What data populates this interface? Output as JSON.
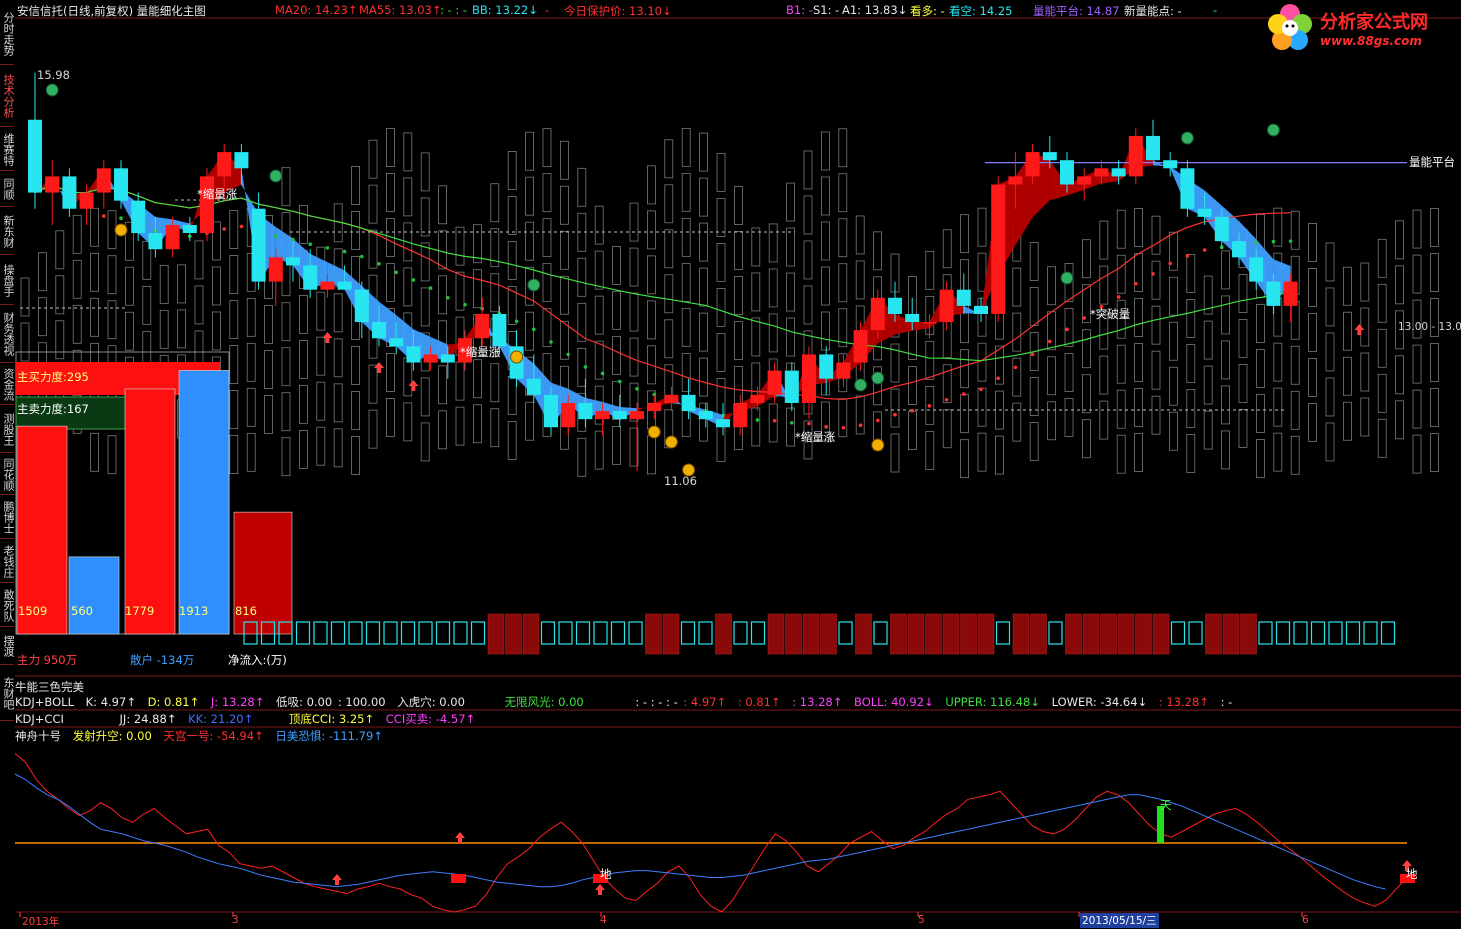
{
  "sidebar": {
    "tabs": [
      {
        "label": "分时走势",
        "active": false
      },
      {
        "label": "技术分析",
        "active": true
      },
      {
        "label": "维赛特",
        "active": false
      },
      {
        "label": "同顺",
        "active": false
      },
      {
        "label": "新东财",
        "active": false
      },
      {
        "label": "操盘手",
        "active": false
      },
      {
        "label": "财务透视",
        "active": false
      },
      {
        "label": "资金流",
        "active": false
      },
      {
        "label": "测股王",
        "active": false
      },
      {
        "label": "同花顺",
        "active": false
      },
      {
        "label": "鹏博士",
        "active": false
      },
      {
        "label": "老钱庄",
        "active": false
      },
      {
        "label": "敢死队",
        "active": false
      },
      {
        "label": "摆渡",
        "active": false
      },
      {
        "label": "东财吧",
        "active": false
      }
    ]
  },
  "header": {
    "title": "安信信托(日线,前复权) 量能细化主图",
    "ma20": "MA20: 14.23↑",
    "ma55": "MA55: 13.03↑",
    "sep1": ": - : -",
    "bb": "BB: 13.22↓",
    "sep2": "-",
    "protect": "今日保护价: 13.10↓",
    "b1": "B1: -",
    "s1": "S1: -",
    "a1": "A1: 13.83↓",
    "kanduo": "看多: -",
    "kankong": "看空: 14.25",
    "platform": "量能平台: 14.87",
    "newpoint": "新量能点: -",
    "sep3": "-"
  },
  "logo": {
    "text": "分析家公式网",
    "url": "www.88gs.com"
  },
  "annotations": {
    "high": "15.98",
    "low": "11.06",
    "price_right": "13.00 - 13.0",
    "platform_label": "量能平台",
    "shrink_vol": "*缩量涨",
    "breakout": "*突破量"
  },
  "capital_panel": {
    "buy_label": "主买力度:295",
    "sell_label": "主卖力度:167",
    "main_force": "主力 950万",
    "retail": "散户 -134万",
    "net_inflow": "净流入:(万)",
    "bars": [
      {
        "value": 1509,
        "color": "#ff1010"
      },
      {
        "value": 560,
        "color": "#2f8fff"
      },
      {
        "value": 1779,
        "color": "#ff1010"
      },
      {
        "value": 1913,
        "color": "#2f8fff"
      },
      {
        "value": 816,
        "color": "#c00000"
      }
    ],
    "bar_labels": [
      "1509",
      "560",
      "1779",
      "1913",
      "816"
    ]
  },
  "indicators": {
    "row1": {
      "name": "牛能三色完美",
      "name2": "KDJ+BOLL",
      "k": "K: 4.97↑",
      "d": "D: 0.81↑",
      "j": "J: 13.28↑",
      "dixi": "低吸: 0.00",
      "v100": ": 100.00",
      "ruhu": "入虎穴: 0.00",
      "wuxian": "无限风光: 0.00",
      "dots": ": - : - : -",
      "v1": ": 4.97↑",
      "v2": ": 0.81↑",
      "v3": ": 13.28↑",
      "boll": "BOLL: 40.92↓",
      "upper": "UPPER: 116.48↓",
      "lower": "LOWER: -34.64↓",
      "v4": ": 13.28↑",
      "v5": ": -"
    },
    "row2": {
      "name": "KDJ+CCI",
      "jj": "JJ: 24.88↑",
      "kk": "KK: 21.20↑",
      "cci": "顶底CCI: 3.25↑",
      "ccibs": "CCI买卖: -4.57↑"
    },
    "row3": {
      "name": "神舟十号",
      "fashe": "发射升空: 0.00",
      "tiangong": "天宫一号: -54.94↑",
      "rimei": "日美恐惧: -111.79↑"
    },
    "marks": {
      "tian": "天",
      "di": "地"
    }
  },
  "xaxis": {
    "labels": [
      "2013年",
      "3",
      "4",
      "5",
      "2013/05/15/三",
      "6"
    ]
  },
  "chart_data": {
    "type": "candlestick",
    "title": "安信信托(日线,前复权) 量能细化主图",
    "high_label": 15.98,
    "low_label": 11.06,
    "ohlc": [
      [
        15.4,
        15.98,
        14.3,
        14.5
      ],
      [
        14.5,
        14.9,
        14.1,
        14.7
      ],
      [
        14.7,
        14.8,
        14.2,
        14.3
      ],
      [
        14.3,
        14.6,
        14.1,
        14.5
      ],
      [
        14.5,
        14.9,
        14.3,
        14.8
      ],
      [
        14.8,
        14.9,
        14.3,
        14.4
      ],
      [
        14.4,
        14.5,
        13.9,
        14.0
      ],
      [
        14.0,
        14.2,
        13.7,
        13.8
      ],
      [
        13.8,
        14.2,
        13.7,
        14.1
      ],
      [
        14.1,
        14.2,
        13.9,
        14.0
      ],
      [
        14.0,
        14.8,
        13.9,
        14.7
      ],
      [
        14.7,
        15.1,
        14.4,
        15.0
      ],
      [
        15.0,
        15.1,
        14.6,
        14.8
      ],
      [
        14.3,
        14.5,
        13.3,
        13.4
      ],
      [
        13.4,
        13.8,
        13.1,
        13.7
      ],
      [
        13.7,
        13.9,
        13.4,
        13.6
      ],
      [
        13.6,
        13.8,
        13.2,
        13.3
      ],
      [
        13.3,
        13.5,
        13.2,
        13.4
      ],
      [
        13.4,
        13.6,
        13.3,
        13.3
      ],
      [
        13.3,
        13.4,
        12.7,
        12.9
      ],
      [
        12.9,
        13.1,
        12.6,
        12.7
      ],
      [
        12.7,
        12.9,
        12.5,
        12.6
      ],
      [
        12.6,
        12.8,
        12.3,
        12.4
      ],
      [
        12.4,
        12.6,
        12.3,
        12.5
      ],
      [
        12.5,
        12.6,
        12.2,
        12.4
      ],
      [
        12.4,
        12.8,
        12.3,
        12.7
      ],
      [
        12.7,
        13.2,
        12.6,
        13.0
      ],
      [
        13.0,
        13.1,
        12.5,
        12.6
      ],
      [
        12.6,
        12.8,
        12.1,
        12.2
      ],
      [
        12.2,
        12.5,
        11.9,
        12.0
      ],
      [
        12.0,
        12.1,
        11.5,
        11.6
      ],
      [
        11.6,
        12.0,
        11.5,
        11.9
      ],
      [
        11.9,
        12.2,
        11.6,
        11.7
      ],
      [
        11.7,
        11.9,
        11.5,
        11.8
      ],
      [
        11.8,
        12.0,
        11.6,
        11.7
      ],
      [
        11.7,
        11.9,
        11.06,
        11.8
      ],
      [
        11.8,
        12.0,
        11.7,
        11.9
      ],
      [
        11.9,
        12.1,
        11.8,
        12.0
      ],
      [
        12.0,
        12.2,
        11.7,
        11.8
      ],
      [
        11.8,
        11.9,
        11.6,
        11.7
      ],
      [
        11.7,
        11.9,
        11.5,
        11.6
      ],
      [
        11.6,
        12.0,
        11.5,
        11.9
      ],
      [
        11.9,
        12.1,
        11.8,
        12.0
      ],
      [
        12.0,
        12.4,
        11.9,
        12.3
      ],
      [
        12.3,
        12.4,
        11.8,
        11.9
      ],
      [
        11.9,
        12.6,
        11.7,
        12.5
      ],
      [
        12.5,
        12.6,
        12.0,
        12.2
      ],
      [
        12.2,
        12.5,
        12.1,
        12.4
      ],
      [
        12.4,
        12.9,
        12.3,
        12.8
      ],
      [
        12.8,
        13.3,
        12.7,
        13.2
      ],
      [
        13.2,
        13.4,
        12.9,
        13.0
      ],
      [
        13.0,
        13.2,
        12.8,
        12.9
      ],
      [
        12.9,
        13.0,
        12.7,
        12.9
      ],
      [
        12.9,
        13.4,
        12.8,
        13.3
      ],
      [
        13.3,
        13.5,
        13.0,
        13.1
      ],
      [
        13.1,
        13.2,
        12.9,
        13.0
      ],
      [
        13.0,
        14.7,
        12.9,
        14.6
      ],
      [
        14.6,
        15.0,
        14.3,
        14.7
      ],
      [
        14.7,
        15.1,
        14.6,
        15.0
      ],
      [
        15.0,
        15.2,
        14.8,
        14.9
      ],
      [
        14.9,
        15.0,
        14.5,
        14.6
      ],
      [
        14.6,
        14.8,
        14.4,
        14.7
      ],
      [
        14.7,
        14.9,
        14.6,
        14.8
      ],
      [
        14.8,
        14.9,
        14.6,
        14.7
      ],
      [
        14.7,
        15.3,
        14.6,
        15.2
      ],
      [
        15.2,
        15.4,
        15.0,
        14.9
      ],
      [
        14.9,
        15.0,
        14.7,
        14.8
      ],
      [
        14.8,
        14.9,
        14.2,
        14.3
      ],
      [
        14.3,
        14.5,
        14.1,
        14.2
      ],
      [
        14.2,
        14.3,
        13.8,
        13.9
      ],
      [
        13.9,
        14.0,
        13.6,
        13.7
      ],
      [
        13.7,
        13.8,
        13.3,
        13.4
      ],
      [
        13.4,
        13.5,
        13.0,
        13.1
      ],
      [
        13.1,
        13.5,
        12.9,
        13.4
      ]
    ],
    "ma20_last": 14.23,
    "ma55_last": 13.03,
    "platform_level": 14.87,
    "osc_red": [
      78,
      70,
      55,
      45,
      38,
      30,
      24,
      28,
      35,
      30,
      22,
      18,
      25,
      30,
      22,
      15,
      8,
      10,
      12,
      -2,
      -8,
      -18,
      -20,
      -22,
      -20,
      -25,
      -30,
      -35,
      -38,
      -40,
      -42,
      -44,
      -40,
      -38,
      -35,
      -38,
      -40,
      -45,
      -48,
      -55,
      -58,
      -60,
      -58,
      -55,
      -45,
      -30,
      -18,
      -12,
      -5,
      5,
      12,
      18,
      10,
      0,
      -15,
      -30,
      -40,
      -48,
      -50,
      -42,
      -35,
      -25,
      -20,
      -30,
      -45,
      -55,
      -60,
      -50,
      -35,
      -20,
      -5,
      8,
      2,
      -8,
      -20,
      -25,
      -18,
      -10,
      0,
      5,
      10,
      2,
      -5,
      -2,
      5,
      10,
      18,
      25,
      30,
      38,
      40,
      42,
      45,
      35,
      25,
      15,
      10,
      8,
      12,
      20,
      30,
      40,
      45,
      42,
      35,
      25,
      15,
      8,
      5,
      10,
      15,
      20,
      25,
      28,
      30,
      25,
      18,
      10,
      2,
      -5,
      -12,
      -20,
      -28,
      -35,
      -42,
      -48,
      -52,
      -55,
      -50,
      -40,
      -30
    ],
    "osc_blue": [
      60,
      55,
      48,
      42,
      38,
      32,
      25,
      18,
      12,
      10,
      8,
      5,
      2,
      0,
      -2,
      -5,
      -8,
      -12,
      -15,
      -18,
      -20,
      -22,
      -25,
      -28,
      -30,
      -32,
      -34,
      -35,
      -36,
      -37,
      -38,
      -37,
      -36,
      -34,
      -32,
      -30,
      -28,
      -27,
      -26,
      -25,
      -26,
      -27,
      -28,
      -30,
      -32,
      -34,
      -35,
      -36,
      -37,
      -38,
      -38,
      -37,
      -35,
      -32,
      -30,
      -28,
      -26,
      -25,
      -24,
      -24,
      -25,
      -26,
      -27,
      -28,
      -29,
      -30,
      -30,
      -29,
      -28,
      -26,
      -24,
      -22,
      -20,
      -18,
      -16,
      -15,
      -14,
      -12,
      -10,
      -8,
      -6,
      -4,
      -2,
      0,
      2,
      4,
      6,
      8,
      10,
      12,
      14,
      16,
      18,
      20,
      22,
      24,
      26,
      28,
      30,
      32,
      34,
      36,
      38,
      40,
      42,
      42,
      40,
      38,
      35,
      32,
      28,
      24,
      20,
      16,
      12,
      8,
      4,
      0,
      -4,
      -8,
      -12,
      -16,
      -20,
      -24,
      -28,
      -32,
      -35,
      -38,
      -40
    ],
    "osc_zero": 0
  },
  "colors": {
    "up": "#ff1a1a",
    "down": "#27e6f0",
    "ribbon_down": "#3f9fff",
    "ribbon_up": "#b80000",
    "ma20": "#ff3030",
    "ma55": "#40e040",
    "platform": "#8080ff",
    "orange_line": "#ff8c00"
  }
}
